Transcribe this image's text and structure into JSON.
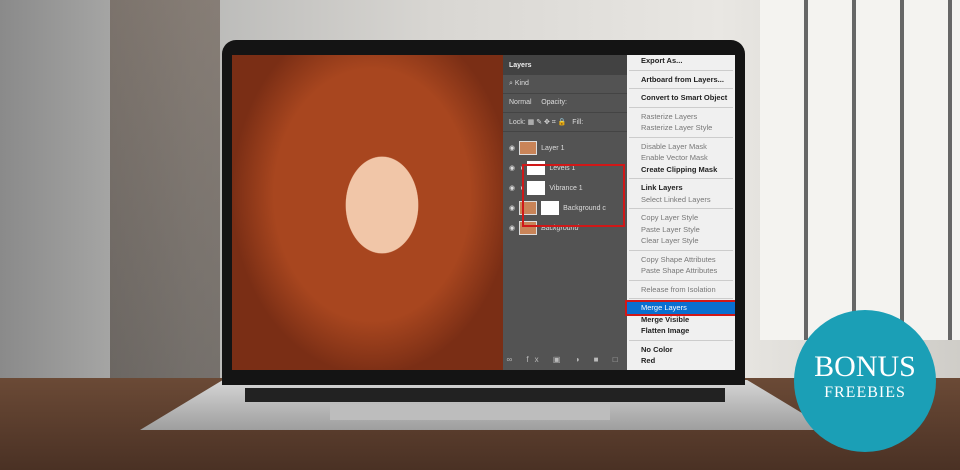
{
  "layers_panel": {
    "tab": "Layers",
    "filter": "Kind",
    "blend_mode": "Normal",
    "opacity_label": "Opacity:",
    "lock_label": "Lock:",
    "fill_label": "Fill:",
    "layers": [
      "Layer 1",
      "Levels 1",
      "Vibrance 1",
      "Background c",
      "Background"
    ],
    "bottom_icons": "∞ fx ▣ ◑ ■ □"
  },
  "context_menu": {
    "items": [
      {
        "label": "Export As...",
        "enabled": true
      },
      {
        "label": "Artboard from Layers...",
        "enabled": true
      },
      {
        "label": "Convert to Smart Object",
        "enabled": true
      },
      {
        "label": "Rasterize Layers",
        "enabled": false
      },
      {
        "label": "Rasterize Layer Style",
        "enabled": false
      },
      {
        "label": "Disable Layer Mask",
        "enabled": false
      },
      {
        "label": "Enable Vector Mask",
        "enabled": false
      },
      {
        "label": "Create Clipping Mask",
        "enabled": true
      },
      {
        "label": "Link Layers",
        "enabled": true
      },
      {
        "label": "Select Linked Layers",
        "enabled": false
      },
      {
        "label": "Copy Layer Style",
        "enabled": false
      },
      {
        "label": "Paste Layer Style",
        "enabled": false
      },
      {
        "label": "Clear Layer Style",
        "enabled": false
      },
      {
        "label": "Copy Shape Attributes",
        "enabled": false
      },
      {
        "label": "Paste Shape Attributes",
        "enabled": false
      },
      {
        "label": "Release from Isolation",
        "enabled": false
      },
      {
        "label": "Merge Layers",
        "enabled": true,
        "highlighted": true
      },
      {
        "label": "Merge Visible",
        "enabled": true
      },
      {
        "label": "Flatten Image",
        "enabled": true
      },
      {
        "label": "No Color",
        "enabled": true
      },
      {
        "label": "Red",
        "enabled": true
      }
    ]
  },
  "badge": {
    "line1": "BONUS",
    "line2": "FREEBIES",
    "color": "#1b9fb6"
  }
}
